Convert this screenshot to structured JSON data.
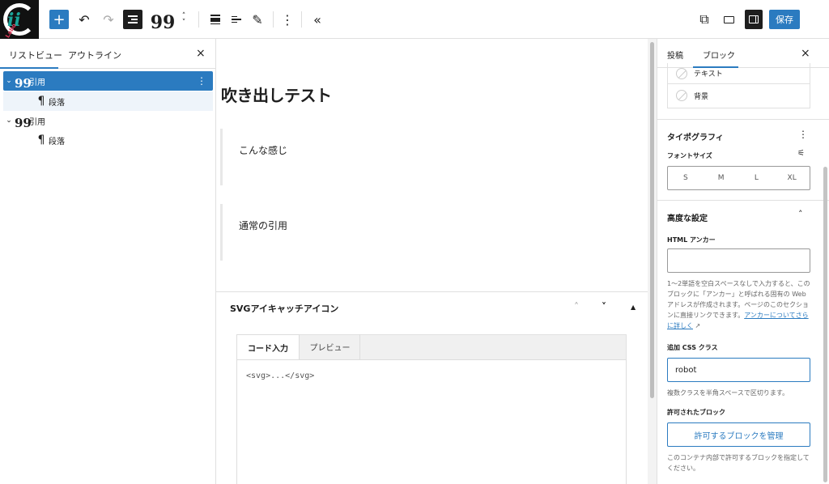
{
  "toolbar": {
    "add_label": "+",
    "undo_icon": "↶",
    "redo_icon": "↷",
    "quote_icon": "99",
    "move_up": "˄",
    "move_down": "˅",
    "more_icon": "⋮",
    "collapse_icon": "«",
    "external_icon": "⧉",
    "save_label": "保存"
  },
  "listview": {
    "tabs": [
      "リストビュー",
      "アウトライン"
    ],
    "close": "×",
    "items": [
      {
        "label": "引用",
        "type": "quote"
      },
      {
        "label": "段落",
        "type": "paragraph"
      },
      {
        "label": "引用",
        "type": "quote"
      },
      {
        "label": "段落",
        "type": "paragraph"
      }
    ]
  },
  "editor": {
    "title": "吹き出しテスト",
    "quotes": [
      "こんな感じ",
      "通常の引用"
    ],
    "metabox": {
      "title": "SVGアイキャッチアイコン",
      "tabs": [
        "コード入力",
        "プレビュー"
      ],
      "code": "<svg>...</svg>"
    }
  },
  "settings": {
    "tabs": [
      "投稿",
      "ブロック"
    ],
    "close": "×",
    "colors": [
      "テキスト",
      "背景"
    ],
    "typography": {
      "title": "タイポグラフィ",
      "font_size_label": "フォントサイズ",
      "sizes": [
        "S",
        "M",
        "L",
        "XL"
      ]
    },
    "advanced": {
      "title": "高度な設定",
      "html_anchor_label": "HTML アンカー",
      "html_anchor_value": "",
      "html_anchor_help": "1〜2単語を空白スペースなしで入力すると、このブロックに「アンカー」と呼ばれる固有の Web アドレスが作成されます。ページのこのセクションに直接リンクできます。",
      "html_anchor_link": "アンカーについてさらに詳しく",
      "link_arrow": "↗",
      "css_label": "追加 CSS クラス",
      "css_value": "robot",
      "css_help": "複数クラスを半角スペースで区切ります。",
      "allowed_label": "許可されたブロック",
      "manage_button": "許可するブロックを管理",
      "allowed_help": "このコンテナ内部で許可するブロックを指定してください。"
    }
  }
}
